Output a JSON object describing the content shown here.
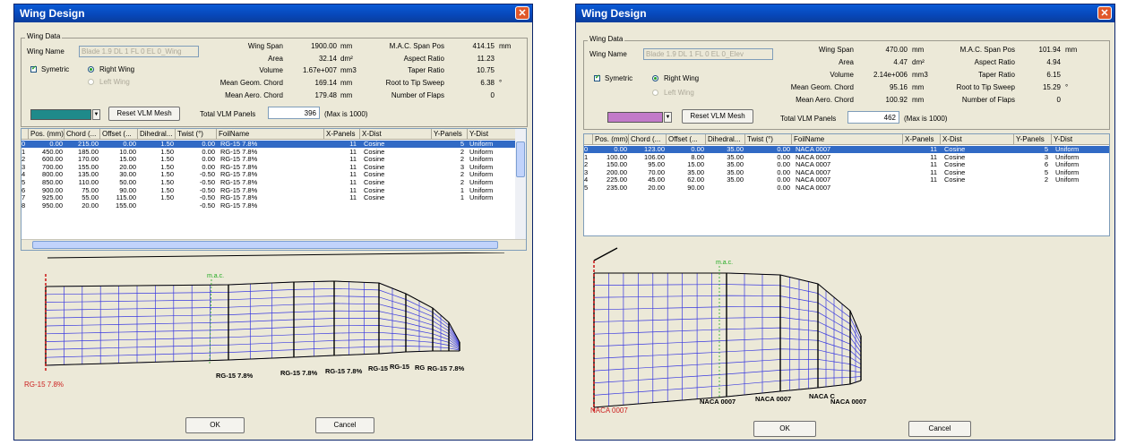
{
  "colors": {
    "titlebar": "#0a4fc4",
    "mac": "#22aa22",
    "root_label": "#cc2020",
    "mesh": "#3a3ae0",
    "selection": "#316ac5"
  },
  "windows": [
    {
      "title": "Wing Design",
      "group_label": "Wing Data",
      "wing_name_label": "Wing Name",
      "wing_name_value": "Blade 1.9 DL 1 FL 0 EL 0_Wing",
      "symmetric_label": "Symetric",
      "right_wing_label": "Right Wing",
      "left_wing_label": "Left Wing",
      "props": [
        {
          "label": "Wing Span",
          "value": "1900.00",
          "unit": "mm"
        },
        {
          "label": "Area",
          "value": "32.14",
          "unit": "dm²"
        },
        {
          "label": "Volume",
          "value": "1.67e+007",
          "unit": "mm3"
        },
        {
          "label": "Mean Geom. Chord",
          "value": "169.14",
          "unit": "mm"
        },
        {
          "label": "Mean Aero. Chord",
          "value": "179.48",
          "unit": "mm"
        }
      ],
      "props2": [
        {
          "label": "M.A.C. Span Pos",
          "value": "414.15",
          "unit": "mm"
        },
        {
          "label": "Aspect Ratio",
          "value": "11.23",
          "unit": ""
        },
        {
          "label": "Taper Ratio",
          "value": "10.75",
          "unit": ""
        },
        {
          "label": "Root to Tip Sweep",
          "value": "6.38",
          "unit": "°"
        },
        {
          "label": "Number of Flaps",
          "value": "0",
          "unit": ""
        }
      ],
      "color_swatch": "#1f8a8a",
      "reset_label": "Reset VLM Mesh",
      "vlm_label": "Total VLM Panels",
      "vlm_value": "396",
      "vlm_max": "(Max is 1000)",
      "columns": [
        "",
        "Pos. (mm)",
        "Chord (...",
        "Offset (...",
        "Dihedral...",
        "Twist (°)",
        "FoilName",
        "X-Panels",
        "X-Dist",
        "Y-Panels",
        "Y-Dist"
      ],
      "rows": [
        [
          "0",
          "0.00",
          "215.00",
          "0.00",
          "1.50",
          "0.00",
          "RG-15 7.8%",
          "11",
          "Cosine",
          "5",
          "Uniform"
        ],
        [
          "1",
          "450.00",
          "185.00",
          "10.00",
          "1.50",
          "0.00",
          "RG-15 7.8%",
          "11",
          "Cosine",
          "2",
          "Uniform"
        ],
        [
          "2",
          "600.00",
          "170.00",
          "15.00",
          "1.50",
          "0.00",
          "RG-15 7.8%",
          "11",
          "Cosine",
          "2",
          "Uniform"
        ],
        [
          "3",
          "700.00",
          "155.00",
          "20.00",
          "1.50",
          "0.00",
          "RG-15 7.8%",
          "11",
          "Cosine",
          "3",
          "Uniform"
        ],
        [
          "4",
          "800.00",
          "135.00",
          "30.00",
          "1.50",
          "-0.50",
          "RG-15 7.8%",
          "11",
          "Cosine",
          "2",
          "Uniform"
        ],
        [
          "5",
          "850.00",
          "110.00",
          "50.00",
          "1.50",
          "-0.50",
          "RG-15 7.8%",
          "11",
          "Cosine",
          "2",
          "Uniform"
        ],
        [
          "6",
          "900.00",
          "75.00",
          "90.00",
          "1.50",
          "-0.50",
          "RG-15 7.8%",
          "11",
          "Cosine",
          "1",
          "Uniform"
        ],
        [
          "7",
          "925.00",
          "55.00",
          "115.00",
          "1.50",
          "-0.50",
          "RG-15 7.8%",
          "11",
          "Cosine",
          "1",
          "Uniform"
        ],
        [
          "8",
          "950.00",
          "20.00",
          "155.00",
          "",
          "-0.50",
          "RG-15 7.8%",
          "",
          "",
          "",
          ""
        ]
      ],
      "selected_row": 0,
      "mac_label": "m.a.c.",
      "root_label": "RG-15 7.8%",
      "section_labels": [
        "RG-15 7.8%",
        "RG-15 7.8%",
        "RG-15 7.8%",
        "RG-15",
        "RG-15",
        "RG",
        "RG-15 7.8%"
      ],
      "ok_label": "OK",
      "cancel_label": "Cancel"
    },
    {
      "title": "Wing Design",
      "group_label": "Wing Data",
      "wing_name_label": "Wing Name",
      "wing_name_value": "Blade 1.9 DL 1 FL 0 EL 0_Elev",
      "symmetric_label": "Symetric",
      "right_wing_label": "Right Wing",
      "left_wing_label": "Left Wing",
      "props": [
        {
          "label": "Wing Span",
          "value": "470.00",
          "unit": "mm"
        },
        {
          "label": "Area",
          "value": "4.47",
          "unit": "dm²"
        },
        {
          "label": "Volume",
          "value": "2.14e+006",
          "unit": "mm3"
        },
        {
          "label": "Mean Geom. Chord",
          "value": "95.16",
          "unit": "mm"
        },
        {
          "label": "Mean Aero. Chord",
          "value": "100.92",
          "unit": "mm"
        }
      ],
      "props2": [
        {
          "label": "M.A.C. Span Pos",
          "value": "101.94",
          "unit": "mm"
        },
        {
          "label": "Aspect Ratio",
          "value": "4.94",
          "unit": ""
        },
        {
          "label": "Taper Ratio",
          "value": "6.15",
          "unit": ""
        },
        {
          "label": "Root to Tip Sweep",
          "value": "15.29",
          "unit": "°"
        },
        {
          "label": "Number of Flaps",
          "value": "0",
          "unit": ""
        }
      ],
      "color_swatch": "#c27ac9",
      "reset_label": "Reset VLM Mesh",
      "vlm_label": "Total VLM Panels",
      "vlm_value": "462",
      "vlm_max": "(Max is 1000)",
      "columns": [
        "",
        "Pos. (mm)",
        "Chord (...",
        "Offset (...",
        "Dihedral...",
        "Twist (°)",
        "FoilName",
        "X-Panels",
        "X-Dist",
        "Y-Panels",
        "Y-Dist"
      ],
      "rows": [
        [
          "0",
          "0.00",
          "123.00",
          "0.00",
          "35.00",
          "0.00",
          "NACA 0007",
          "11",
          "Cosine",
          "5",
          "Uniform"
        ],
        [
          "1",
          "100.00",
          "106.00",
          "8.00",
          "35.00",
          "0.00",
          "NACA 0007",
          "11",
          "Cosine",
          "3",
          "Uniform"
        ],
        [
          "2",
          "150.00",
          "95.00",
          "15.00",
          "35.00",
          "0.00",
          "NACA 0007",
          "11",
          "Cosine",
          "6",
          "Uniform"
        ],
        [
          "3",
          "200.00",
          "70.00",
          "35.00",
          "35.00",
          "0.00",
          "NACA 0007",
          "11",
          "Cosine",
          "5",
          "Uniform"
        ],
        [
          "4",
          "225.00",
          "45.00",
          "62.00",
          "35.00",
          "0.00",
          "NACA 0007",
          "11",
          "Cosine",
          "2",
          "Uniform"
        ],
        [
          "5",
          "235.00",
          "20.00",
          "90.00",
          "",
          "0.00",
          "NACA 0007",
          "",
          "",
          "",
          ""
        ]
      ],
      "selected_row": 0,
      "mac_label": "m.a.c.",
      "root_label": "NACA 0007",
      "section_labels": [
        "NACA 0007",
        "NACA 0007",
        "NACA C",
        "NACA 0007"
      ],
      "ok_label": "OK",
      "cancel_label": "Cancel"
    }
  ]
}
